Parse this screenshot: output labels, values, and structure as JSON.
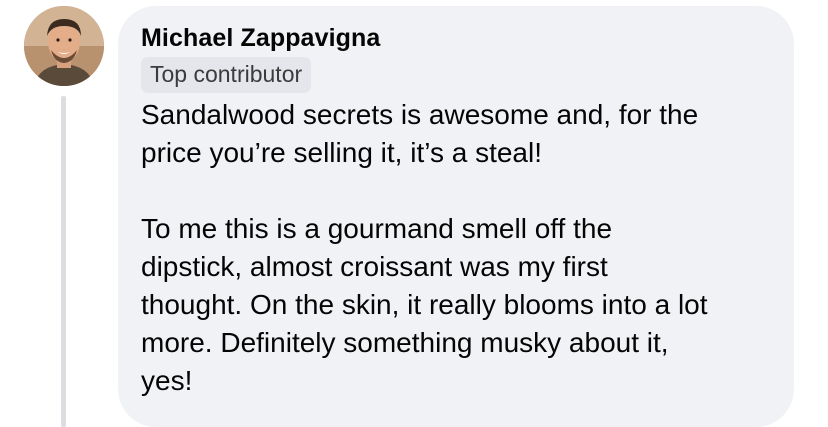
{
  "comment": {
    "author": "Michael Zappavigna",
    "badge": "Top contributor",
    "paragraph_1": "Sandalwood secrets is awesome and, for the\nprice you’re selling it, it’s a steal!",
    "paragraph_2": "To me this is a gourmand smell off the\ndipstick, almost croissant was my first\nthought. On the skin, it really blooms into a lot\nmore. Definitely something musky about it,\nyes!"
  },
  "colors": {
    "bubble_background": "#f0f2f5",
    "badge_background": "#e4e6eb",
    "text": "#050505",
    "thread_line": "#dcdde1"
  },
  "icons": {
    "avatar": "user-profile-photo"
  }
}
